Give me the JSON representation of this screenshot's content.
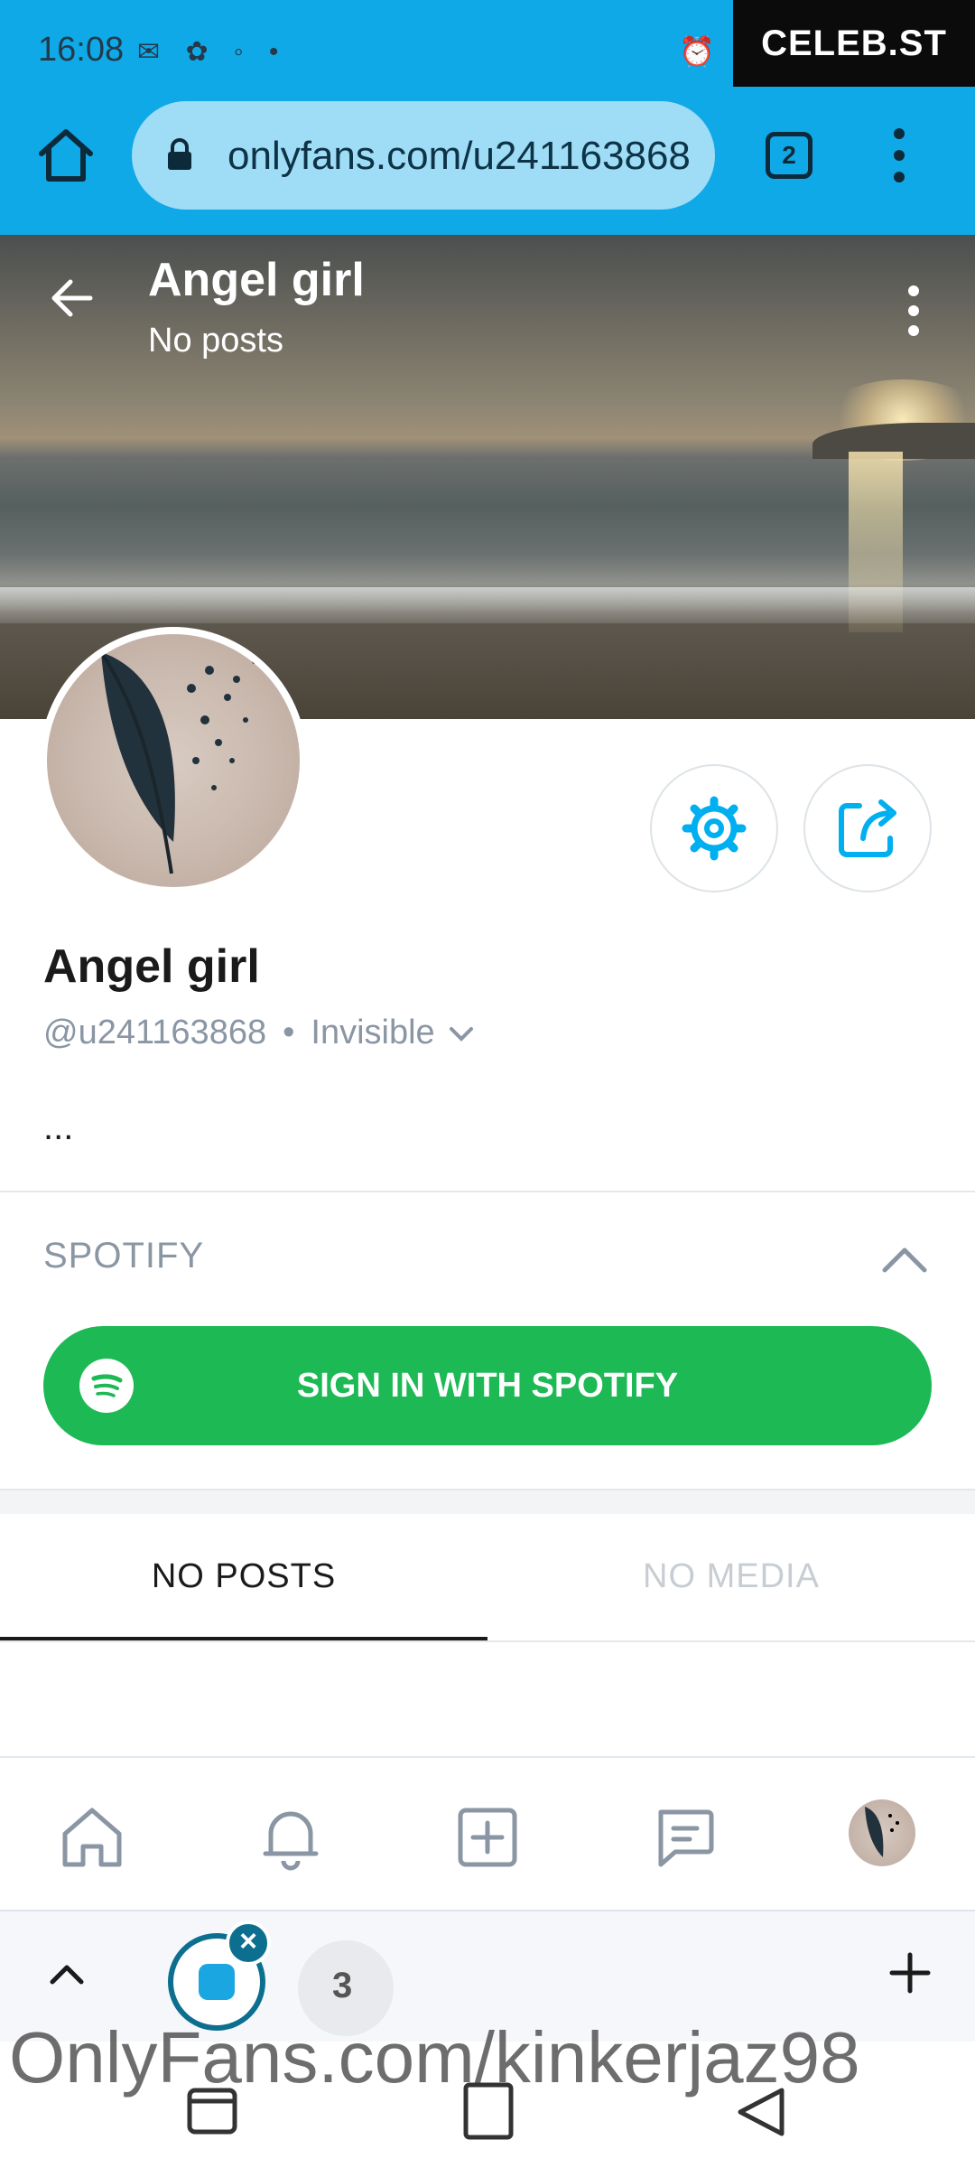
{
  "status_bar": {
    "time": "16:08",
    "watermark_badge": "CELEB.ST"
  },
  "browser": {
    "url": "onlyfans.com/u241163868",
    "tab_count": "2"
  },
  "cover": {
    "title": "Angel girl",
    "subtitle": "No posts"
  },
  "profile": {
    "name": "Angel girl",
    "handle": "@u241163868",
    "separator": "•",
    "status": "Invisible",
    "bio": "..."
  },
  "spotify": {
    "section_title": "SPOTIFY",
    "button_label": "SIGN IN WITH SPOTIFY"
  },
  "content_tabs": [
    {
      "label": "NO POSTS",
      "active": true
    },
    {
      "label": "NO MEDIA",
      "active": false
    }
  ],
  "app_nav": [
    {
      "icon": "home-icon"
    },
    {
      "icon": "bell-icon"
    },
    {
      "icon": "add-post-icon"
    },
    {
      "icon": "messages-icon"
    },
    {
      "icon": "avatar"
    }
  ],
  "browser_bottom": {
    "close_glyph": "×",
    "second_tab_glyph": "3"
  },
  "watermark": "OnlyFans.com/kinkerjaz98",
  "colors": {
    "chrome_blue": "#0fa9e8",
    "accent": "#00aff0",
    "spotify_green": "#1db954"
  }
}
